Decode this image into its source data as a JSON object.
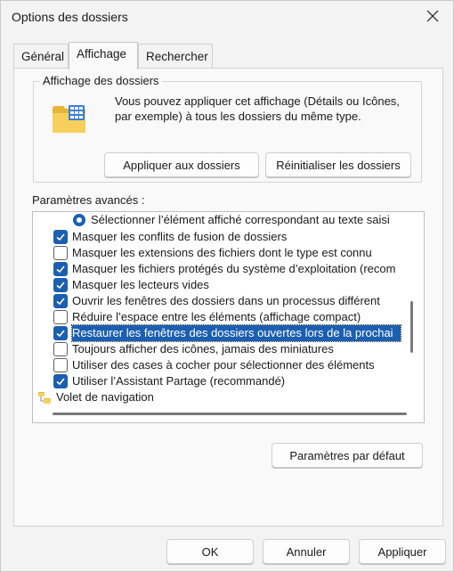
{
  "window": {
    "title": "Options des dossiers"
  },
  "tabs": [
    {
      "label": "Général",
      "active": false
    },
    {
      "label": "Affichage",
      "active": true
    },
    {
      "label": "Rechercher",
      "active": false
    }
  ],
  "folder_view": {
    "title": "Affichage des dossiers",
    "description": "Vous pouvez appliquer cet affichage (Détails ou Icônes, par exemple) à tous les dossiers du même type.",
    "apply_label": "Appliquer aux dossiers",
    "reset_label": "Réinitialiser les dossiers"
  },
  "advanced": {
    "label": "Paramètres avancés :",
    "items": [
      {
        "type": "radio",
        "checked": true,
        "label": "Sélectionner l’élément affiché correspondant au texte saisi"
      },
      {
        "type": "checkbox",
        "checked": true,
        "label": "Masquer les conflits de fusion de dossiers"
      },
      {
        "type": "checkbox",
        "checked": false,
        "label": "Masquer les extensions des fichiers dont le type est connu"
      },
      {
        "type": "checkbox",
        "checked": true,
        "label": "Masquer les fichiers protégés du système d’exploitation (recom"
      },
      {
        "type": "checkbox",
        "checked": true,
        "label": "Masquer les lecteurs vides"
      },
      {
        "type": "checkbox",
        "checked": true,
        "label": "Ouvrir les fenêtres des dossiers dans un processus différent"
      },
      {
        "type": "checkbox",
        "checked": false,
        "label": "Réduire l’espace entre les éléments (affichage compact)"
      },
      {
        "type": "checkbox",
        "checked": true,
        "selected": true,
        "label": "Restaurer les fenêtres des dossiers ouvertes lors de la prochai"
      },
      {
        "type": "checkbox",
        "checked": false,
        "label": "Toujours afficher des icônes, jamais des miniatures"
      },
      {
        "type": "checkbox",
        "checked": false,
        "label": "Utiliser des cases à cocher pour sélectionner des éléments"
      },
      {
        "type": "checkbox",
        "checked": true,
        "label": "Utiliser l’Assistant Partage (recommandé)"
      },
      {
        "type": "folder",
        "label": "Volet de navigation"
      }
    ],
    "defaults_label": "Paramètres par défaut"
  },
  "footer": {
    "ok_label": "OK",
    "cancel_label": "Annuler",
    "apply_label": "Appliquer"
  },
  "colors": {
    "accent": "#1c5fb0",
    "background": "#f3f3f3"
  },
  "icons": {
    "close": "close-icon",
    "folder_view": "folder-grid-icon",
    "nav_pane": "folder-tree-icon"
  }
}
